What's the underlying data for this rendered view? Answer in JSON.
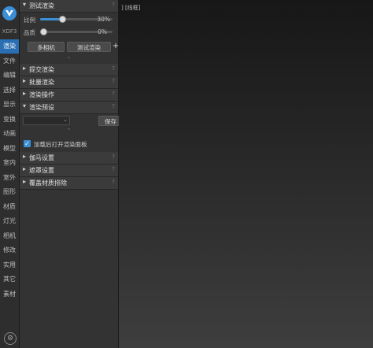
{
  "sidebar": {
    "logo_text": "XDF3",
    "items": [
      {
        "label": "渲染",
        "active": true
      },
      {
        "label": "文件"
      },
      {
        "label": "编辑"
      },
      {
        "label": "选择"
      },
      {
        "label": "显示"
      },
      {
        "label": "变换"
      },
      {
        "label": "动画"
      },
      {
        "label": "模型"
      },
      {
        "label": "室内"
      },
      {
        "label": "室外"
      },
      {
        "label": "图形"
      },
      {
        "label": "材质"
      },
      {
        "label": "灯光"
      },
      {
        "label": "相机"
      },
      {
        "label": "修改"
      },
      {
        "label": "实用"
      },
      {
        "label": "其它"
      },
      {
        "label": "素材"
      }
    ],
    "settings_icon": "gear-icon"
  },
  "panel": {
    "test_render": {
      "title": "测试渲染",
      "help": "?",
      "scale_label": "比例",
      "scale_value_text": "30%",
      "scale_value": 0.3,
      "quality_label": "品质",
      "quality_value_text": "0%",
      "quality_value": 0.0,
      "multi_camera_label": "多相机",
      "test_render_label": "测试渲染",
      "plus_label": "+"
    },
    "sections_mid": [
      {
        "title": "提交渲染",
        "help": "?"
      },
      {
        "title": "批量渲染",
        "help": "?"
      },
      {
        "title": "渲染操作",
        "help": "?"
      }
    ],
    "render_preset": {
      "title": "渲染预设",
      "help": "?",
      "save_label": "保存",
      "close_label": "✕",
      "checkbox_label": "加载后打开渲染面板",
      "checkbox_checked": true
    },
    "sections_bottom": [
      {
        "title": "伽马设置",
        "help": "?"
      },
      {
        "title": "遮罩设置",
        "help": "?"
      },
      {
        "title": "覆盖材质排除",
        "help": "?"
      }
    ]
  },
  "viewport": {
    "label": "] [线框]"
  }
}
